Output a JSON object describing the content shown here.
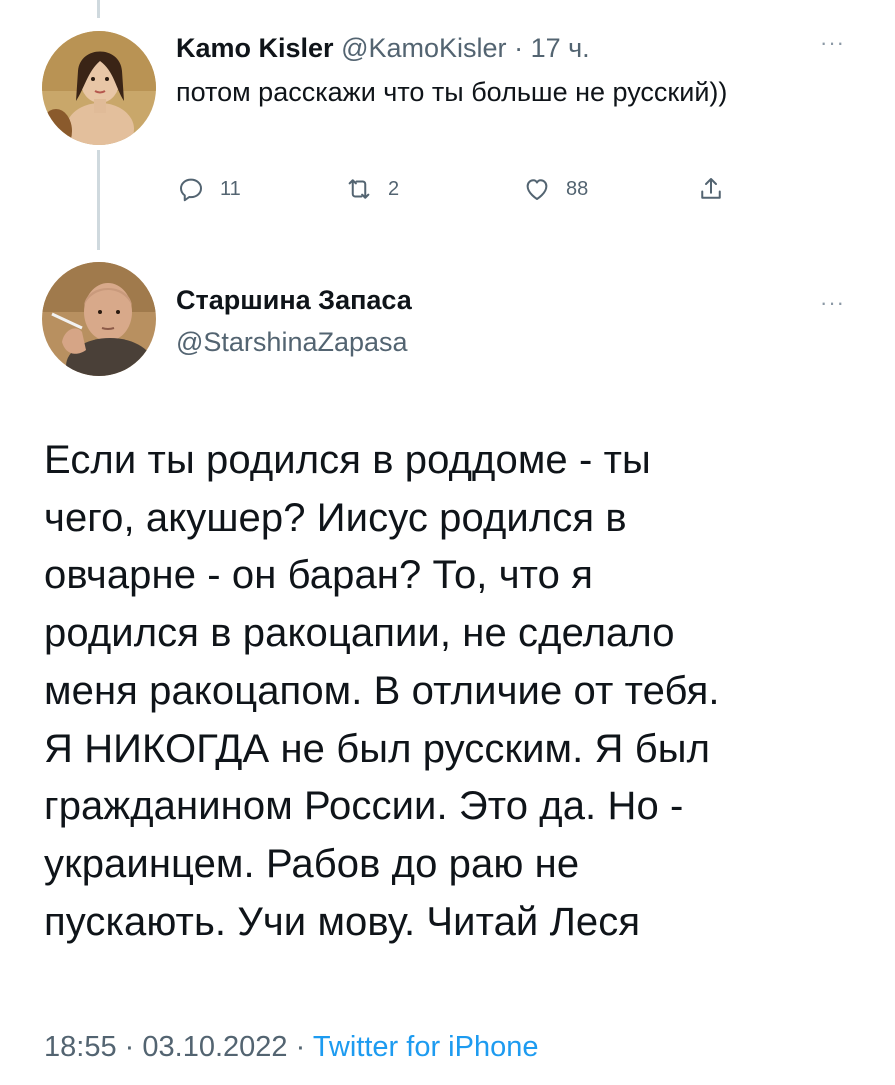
{
  "reply_tweet": {
    "author_name": "Kamo Kisler",
    "author_handle": "@KamoKisler",
    "separator": "·",
    "time": "17 ч.",
    "text": "потом расскажи что ты больше не русский))",
    "more_icon": "more-horizontal-icon",
    "actions": {
      "reply_count": "11",
      "retweet_count": "2",
      "like_count": "88",
      "reply_icon": "reply-icon",
      "retweet_icon": "retweet-icon",
      "like_icon": "heart-icon",
      "share_icon": "share-icon"
    }
  },
  "main_tweet": {
    "author_name": "Старшина Запаса",
    "author_handle": "@StarshinaZapasa",
    "more_icon": "more-horizontal-icon",
    "text_lines": [
      "Если ты родился в роддоме - ты",
      "чего, акушер? Иисус родился в",
      "овчарне - он баран? То, что я",
      "родился в ракоцапии, не сделало",
      "меня ракоцапом. В отличие от тебя.",
      "Я НИКОГДА не был русским. Я был",
      "гражданином России. Это да. Но -",
      "украинцем. Рабов до раю не",
      "пускають. Учи мову. Читай Леся"
    ],
    "time": "18:55",
    "separator": "·",
    "date": "03.10.2022",
    "source": "Twitter for iPhone"
  },
  "colors": {
    "text_primary": "#0f1419",
    "text_secondary": "#536471",
    "link": "#1d9bf0",
    "thread_line": "#cfd9de"
  }
}
